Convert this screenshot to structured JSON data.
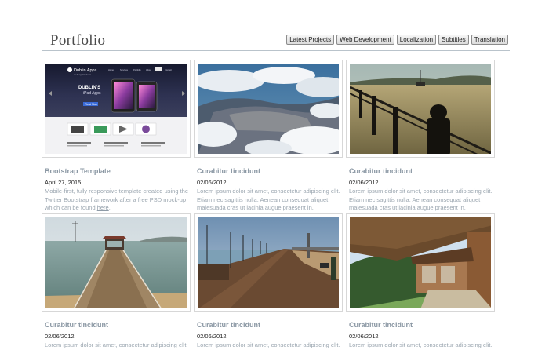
{
  "header": {
    "title": "Portfolio"
  },
  "filters": [
    "Latest Projects",
    "Web Development",
    "Localization",
    "Subtitles",
    "Translation"
  ],
  "mock_site": {
    "brand": "Dublin Apps",
    "brand_sub": "web applications",
    "heading": "DUBLIN'S",
    "heading2": "iPad Apps",
    "cta": "Read More",
    "nav": [
      "Home",
      "Services",
      "Portfolio",
      "About",
      "Contact"
    ]
  },
  "cards": [
    {
      "title": "Bootstrap Template",
      "date": "April 27, 2015",
      "text": "Mobile-first, fully responsive template created using the Twitter Bootstrap framework after a free PSD mock-up which can be found ",
      "link": "here",
      "text_end": "."
    },
    {
      "title": "Curabitur tincidunt",
      "date": "02/06/2012",
      "text": "Lorem ipsum dolor sit amet, consectetur adipiscing elit. Etiam nec sagittis nulla. Aenean consequat aliquet malesuada cras ut lacinia augue praesent in.",
      "link": "",
      "text_end": ""
    },
    {
      "title": "Curabitur tincidunt",
      "date": "02/06/2012",
      "text": "Lorem ipsum dolor sit amet, consectetur adipiscing elit. Etiam nec sagittis nulla. Aenean consequat aliquet malesuada cras ut lacinia augue praesent in.",
      "link": "",
      "text_end": ""
    },
    {
      "title": "Curabitur tincidunt",
      "date": "02/06/2012",
      "text": "Lorem ipsum dolor sit amet, consectetur adipiscing elit.",
      "link": "",
      "text_end": ""
    },
    {
      "title": "Curabitur tincidunt",
      "date": "02/06/2012",
      "text": "Lorem ipsum dolor sit amet, consectetur adipiscing elit.",
      "link": "",
      "text_end": ""
    },
    {
      "title": "Curabitur tincidunt",
      "date": "02/06/2012",
      "text": "Lorem ipsum dolor sit amet, consectetur adipiscing elit.",
      "link": "",
      "text_end": ""
    }
  ]
}
